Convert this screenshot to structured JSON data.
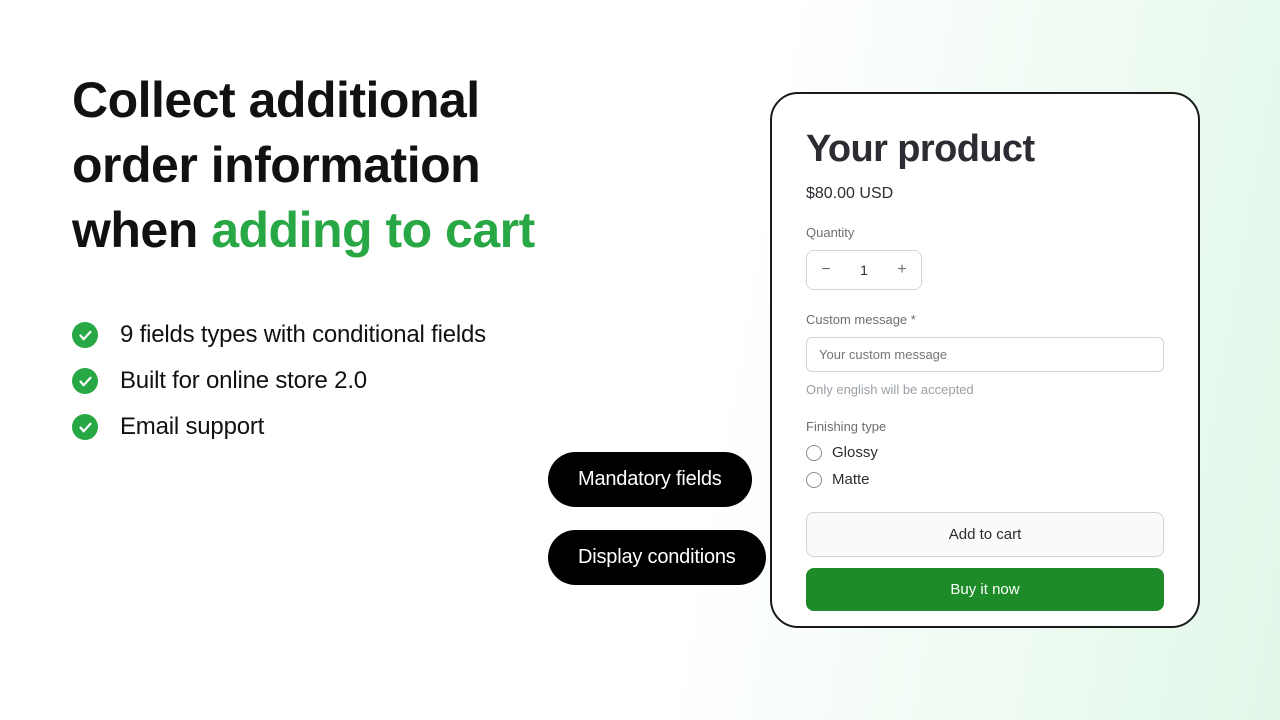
{
  "headline": {
    "line1": "Collect additional",
    "line2": "order information",
    "line3_pre": "when ",
    "line3_accent": "adding to cart"
  },
  "features": [
    "9 fields types with conditional fields",
    "Built for online store 2.0",
    "Email support"
  ],
  "pills": {
    "mandatory": "Mandatory fields",
    "conditions": "Display conditions"
  },
  "product": {
    "title": "Your product",
    "price": "$80.00 USD",
    "qty_label": "Quantity",
    "qty_value": "1",
    "custom_label": "Custom message *",
    "custom_placeholder": "Your custom message",
    "custom_hint": "Only english will be accepted",
    "finishing_label": "Finishing type",
    "finishing_options": [
      "Glossy",
      "Matte"
    ],
    "add_to_cart": "Add to cart",
    "buy_now": "Buy it now"
  },
  "icons": {
    "minus": "−",
    "plus": "+"
  }
}
